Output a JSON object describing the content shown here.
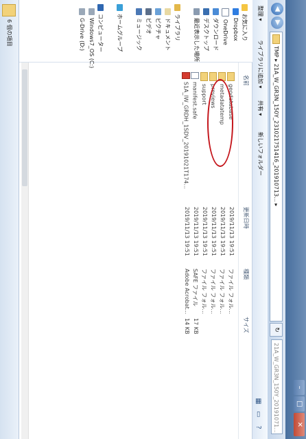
{
  "window": {
    "close_label": "✕",
    "max_label": "□",
    "min_label": "–"
  },
  "address_bar": {
    "path": "TMP ▸ 21A_W_GR3N_150Y_231021751416_201910713... ▸",
    "refresh": "↻",
    "search_placeholder": "21A_W_GR3N_150Y_20191071..."
  },
  "toolbar": {
    "organize": "整理 ▾",
    "library": "ライブラリに追加 ▾",
    "share": "共有 ▾",
    "new_folder": "新しいフォルダー"
  },
  "nav": {
    "items": [
      {
        "label": "お気に入り",
        "icon": "star-icon"
      },
      {
        "label": "Dropbox",
        "icon": "dropbox-icon"
      },
      {
        "label": "OneDrive",
        "icon": "onedrive-icon"
      },
      {
        "label": "ダウンロード",
        "icon": "download-icon"
      },
      {
        "label": "デスクトップ",
        "icon": "desktop-icon"
      },
      {
        "label": "最近表示した場所",
        "icon": "recent-icon"
      },
      {
        "label": "ライブラリ",
        "icon": "library-icon"
      },
      {
        "label": "ドキュメント",
        "icon": "document-icon"
      },
      {
        "label": "ピクチャ",
        "icon": "picture-icon"
      },
      {
        "label": "ビデオ",
        "icon": "video-icon"
      },
      {
        "label": "ミュージック",
        "icon": "music-icon"
      },
      {
        "label": "ホームグループ",
        "icon": "homegroup-icon"
      },
      {
        "label": "コンピューター",
        "icon": "computer-icon"
      },
      {
        "label": "Windows7_OS (C:)",
        "icon": "drive-icon"
      },
      {
        "label": "G-Drive (D:)",
        "icon": "drive-icon"
      }
    ]
  },
  "table": {
    "headers": {
      "name": "名前",
      "date": "更新日時",
      "type": "種類",
      "size": "サイズ"
    },
    "rows": [
      {
        "name": "geodatabase",
        "date": "2019/11/13 19:51",
        "type": "ファイル フォル...",
        "size": "",
        "icon": "folder"
      },
      {
        "name": "metadatatemp",
        "date": "2019/11/13 19:51",
        "type": "ファイル フォル...",
        "size": "",
        "icon": "folder"
      },
      {
        "name": "previews",
        "date": "2019/11/13 19:51",
        "type": "ファイル フォル...",
        "size": "",
        "icon": "folder"
      },
      {
        "name": "support",
        "date": "2019/11/13 19:51",
        "type": "ファイル フォル...",
        "size": "",
        "icon": "folder"
      },
      {
        "name": "manifest.safe",
        "date": "2019/11/13 19:51",
        "type": "SAFE ファイル",
        "size": "17 KB",
        "icon": "file"
      },
      {
        "name": "S1A_IW_GRDH_1SDV_20191021T174...",
        "date": "2019/11/13 19:51",
        "type": "Adobe Acrobat...",
        "size": "14 KB",
        "icon": "pdf"
      }
    ]
  },
  "status": {
    "text": "6 個の項目"
  }
}
